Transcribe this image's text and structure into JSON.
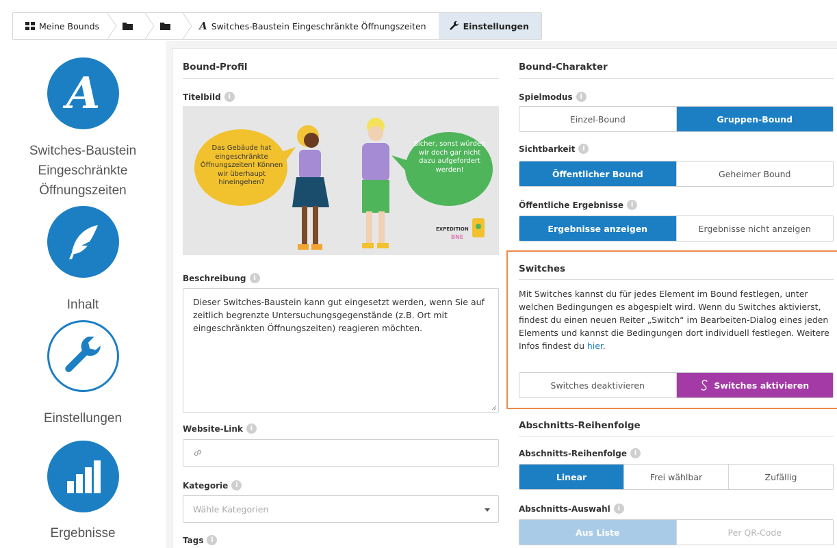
{
  "breadcrumb": {
    "item1": "Meine Bounds",
    "item4": "Switches-Baustein Eingeschränkte Öffnungszeiten",
    "item5": "Einstellungen"
  },
  "sidebar": {
    "bound_title": "Switches-Baustein Eingeschränkte Öffnungszeiten",
    "content_label": "Inhalt",
    "settings_label": "Einstellungen",
    "results_label": "Ergebnisse"
  },
  "profile": {
    "heading": "Bound-Profil",
    "cover_label": "Titelbild",
    "cover": {
      "bubble_left": "Das Gebäude hat eingeschränkte Öffnungszeiten! Können wir überhaupt hineingehen?",
      "bubble_right": "Sicher, sonst würden wir doch gar nicht dazu aufgefordert werden!",
      "logo_line1": "EXPEDITION",
      "logo_line2": "BNE"
    },
    "description_label": "Beschreibung",
    "description": "Dieser Switches-Baustein kann gut eingesetzt werden, wenn Sie auf zeitlich begrenzte Untersuchungsgegenstände (z.B. Ort mit eingeschränkten Öffnungszeiten) reagieren möchten.",
    "website_label": "Website-Link",
    "category_label": "Kategorie",
    "category_placeholder": "Wähle Kategorien",
    "tags_label": "Tags"
  },
  "character": {
    "heading": "Bound-Charakter",
    "mode_label": "Spielmodus",
    "mode_options": [
      "Einzel-Bound",
      "Gruppen-Bound"
    ],
    "visibility_label": "Sichtbarkeit",
    "visibility_options": [
      "Öffentlicher Bound",
      "Geheimer Bound"
    ],
    "results_label": "Öffentliche Ergebnisse",
    "results_options": [
      "Ergebnisse anzeigen",
      "Ergebnisse nicht anzeigen"
    ]
  },
  "switches": {
    "heading": "Switches",
    "text": "Mit Switches kannst du für jedes Element im Bound festlegen, unter welchen Bedingungen es abgespielt wird. Wenn du Switches aktivierst, findest du einen neuen Reiter „Switch“ im Bearbeiten-Dialog eines jeden Elements und kannst die Bedingungen dort individuell festlegen. Weitere Infos findest du",
    "link": "hier",
    "period": ".",
    "deactivate": "Switches deaktivieren",
    "activate": "Switches aktivieren"
  },
  "order": {
    "heading": "Abschnitts-Reihenfolge",
    "order_label": "Abschnitts-Reihenfolge",
    "order_options": [
      "Linear",
      "Frei wählbar",
      "Zufällig"
    ],
    "selection_label": "Abschnitts-Auswahl",
    "selection_options": [
      "Aus Liste",
      "Per QR-Code"
    ]
  },
  "colors": {
    "accent": "#1c7fc4",
    "switch": "#a33aa5",
    "highlight_border": "#ee8a4a"
  }
}
